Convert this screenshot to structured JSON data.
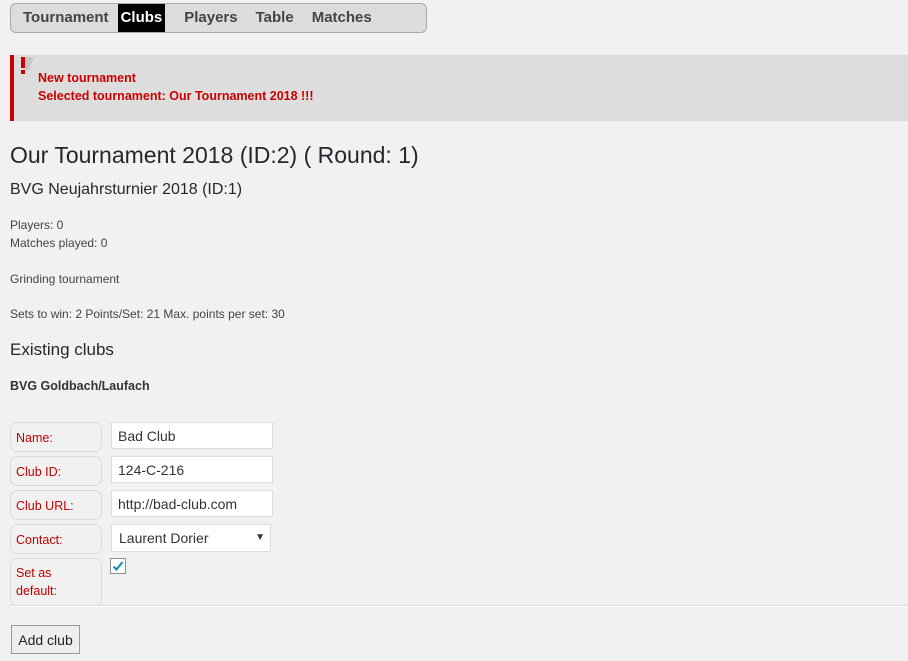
{
  "tabs": [
    {
      "label": "Tournament",
      "active": false
    },
    {
      "label": "Clubs",
      "active": true
    },
    {
      "label": "Players",
      "active": false
    },
    {
      "label": "Table",
      "active": false
    },
    {
      "label": "Matches",
      "active": false
    }
  ],
  "notice": {
    "icon": "exclamation-icon",
    "line1": "New tournament",
    "line2": "Selected tournament: Our Tournament 2018 !!!",
    "color": "#cc0000"
  },
  "tournament": {
    "title": "Our Tournament 2018 (ID:2) ( Round: 1)",
    "subtitle": "BVG Neujahrsturnier 2018 (ID:1)",
    "players": "Players: 0",
    "matches_played": "Matches played: 0",
    "type": "Grinding tournament",
    "rules": "Sets to win: 2 Points/Set: 21 Max. points per set: 30"
  },
  "clubs": {
    "heading": "Existing clubs",
    "existing": [
      "BVG Goldbach/Laufach"
    ]
  },
  "form": {
    "name_label": "Name:",
    "name_value": "Bad Club",
    "club_id_label": "Club ID:",
    "club_id_value": "124-C-216",
    "club_url_label": "Club URL:",
    "club_url_value": "http://bad-club.com",
    "contact_label": "Contact:",
    "contact_value": "Laurent Dorier",
    "default_label_line1": "Set as",
    "default_label_line2": "default:",
    "default_checked": true,
    "submit_label": "Add club"
  },
  "colors": {
    "accent_red": "#cc0000",
    "checkbox_check": "#1e8cbe",
    "active_tab_bg": "#000000"
  }
}
